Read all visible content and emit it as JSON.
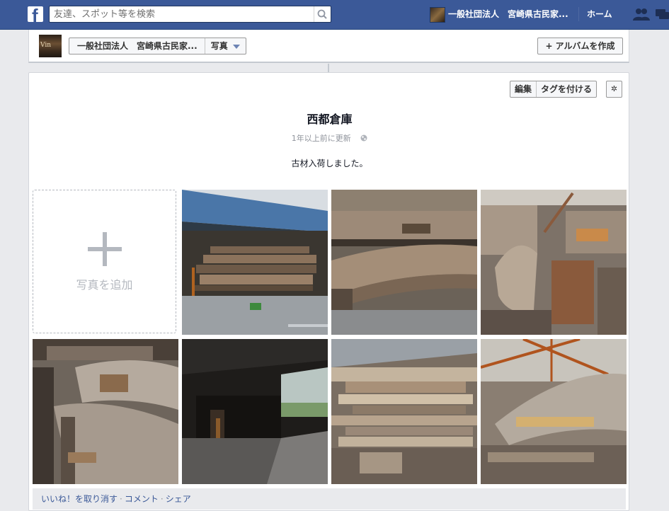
{
  "topbar": {
    "search_placeholder": "友達、スポット等を検索",
    "page_name": "一般社団法人　宮崎県古民家...",
    "home_label": "ホーム"
  },
  "header": {
    "breadcrumb_page": "一般社団法人　宮崎県古民家...",
    "breadcrumb_section": "写真",
    "create_album_label": "アルバムを作成",
    "logo_text": "Vin"
  },
  "album": {
    "edit_label": "編集",
    "tag_label": "タグを付ける",
    "title": "西都倉庫",
    "updated": "1年以上前に更新",
    "description": "古材入荷しました。",
    "add_photo_label": "写真を追加"
  },
  "footer": {
    "unlike": "いいね！を取り消す",
    "comment": "コメント",
    "share": "シェア",
    "separator": "·"
  },
  "colors": {
    "brand": "#3b5998",
    "background": "#e9eaed"
  }
}
